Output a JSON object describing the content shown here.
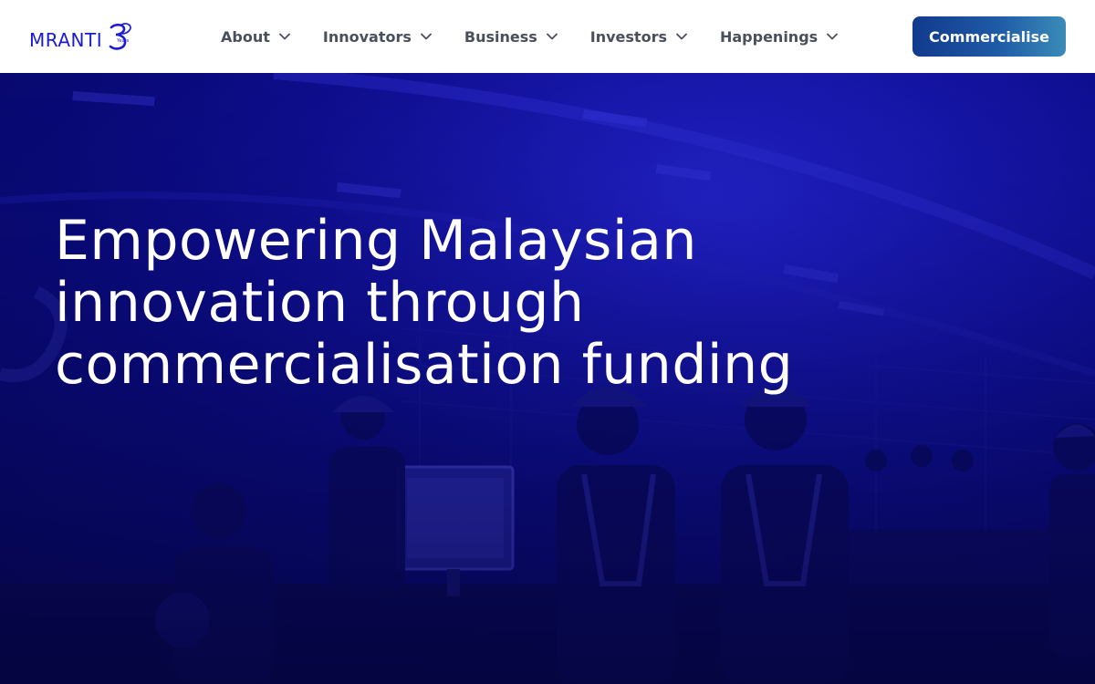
{
  "brand": {
    "logo_text": "MRANTI",
    "logo_years": "Years",
    "primary_color": "#1a1ad6"
  },
  "nav": {
    "items": [
      {
        "label": "About",
        "icon": "chevron-down-icon"
      },
      {
        "label": "Innovators",
        "icon": "chevron-down-icon"
      },
      {
        "label": "Business",
        "icon": "chevron-down-icon"
      },
      {
        "label": "Investors",
        "icon": "chevron-down-icon"
      },
      {
        "label": "Happenings",
        "icon": "chevron-down-icon"
      }
    ],
    "text_color": "#4a4f5c"
  },
  "cta": {
    "label": "Commercialise",
    "gradient_from": "#123a8c",
    "gradient_to": "#3a8bb8"
  },
  "hero": {
    "title": "Empowering Malaysian innovation through commercialisation funding",
    "overlay_color": "#0c0c8a"
  }
}
